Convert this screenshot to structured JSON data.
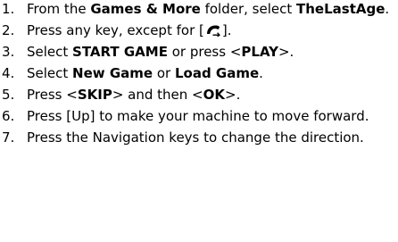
{
  "steps": [
    {
      "number": "1.",
      "parts": [
        {
          "text": "From the ",
          "bold": false
        },
        {
          "text": "Games & More",
          "bold": true
        },
        {
          "text": " folder, select ",
          "bold": false
        },
        {
          "text": "TheLastAge",
          "bold": true
        },
        {
          "text": ".",
          "bold": false
        }
      ]
    },
    {
      "number": "2.",
      "parts": [
        {
          "text": "Press any key, except for [",
          "bold": false
        },
        {
          "icon": "end-call-icon"
        },
        {
          "text": "].",
          "bold": false
        }
      ]
    },
    {
      "number": "3.",
      "parts": [
        {
          "text": "Select ",
          "bold": false
        },
        {
          "text": "START GAME",
          "bold": true
        },
        {
          "text": " or press <",
          "bold": false
        },
        {
          "text": "PLAY",
          "bold": true
        },
        {
          "text": ">.",
          "bold": false
        }
      ]
    },
    {
      "number": "4.",
      "parts": [
        {
          "text": "Select ",
          "bold": false
        },
        {
          "text": "New Game",
          "bold": true
        },
        {
          "text": " or ",
          "bold": false
        },
        {
          "text": "Load Game",
          "bold": true
        },
        {
          "text": ".",
          "bold": false
        }
      ]
    },
    {
      "number": "5.",
      "parts": [
        {
          "text": "Press <",
          "bold": false
        },
        {
          "text": "SKIP",
          "bold": true
        },
        {
          "text": "> and then <",
          "bold": false
        },
        {
          "text": "OK",
          "bold": true
        },
        {
          "text": ">.",
          "bold": false
        }
      ]
    },
    {
      "number": "6.",
      "parts": [
        {
          "text": "Press [Up] to make your machine to move forward.",
          "bold": false
        }
      ]
    },
    {
      "number": "7.",
      "parts": [
        {
          "text": "Press the Navigation keys to change the direction.",
          "bold": false
        }
      ]
    }
  ]
}
